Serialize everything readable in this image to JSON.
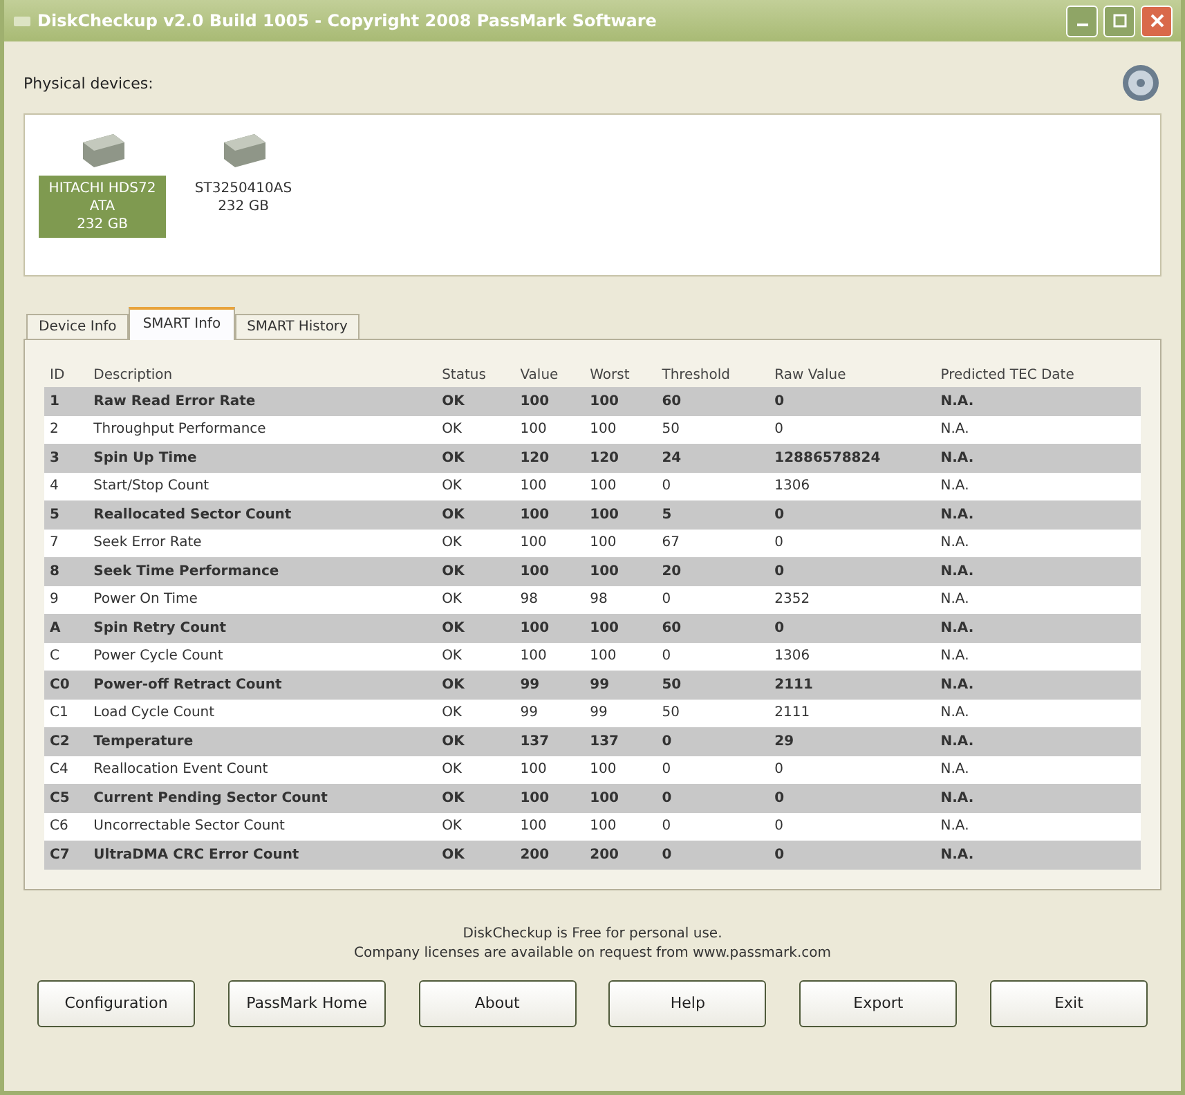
{
  "window": {
    "title": "DiskCheckup v2.0 Build 1005 - Copyright 2008 PassMark Software"
  },
  "devices_label": "Physical devices:",
  "devices": [
    {
      "lines": [
        "HITACHI HDS72",
        "ATA",
        "232 GB"
      ],
      "selected": true
    },
    {
      "lines": [
        "ST3250410AS",
        "232 GB"
      ],
      "selected": false
    }
  ],
  "tabs": [
    {
      "label": "Device Info",
      "selected": false
    },
    {
      "label": "SMART Info",
      "selected": true
    },
    {
      "label": "SMART History",
      "selected": false
    }
  ],
  "table": {
    "columns": [
      "ID",
      "Description",
      "Status",
      "Value",
      "Worst",
      "Threshold",
      "Raw Value",
      "Predicted TEC Date"
    ],
    "rows": [
      [
        "1",
        "Raw Read Error Rate",
        "OK",
        "100",
        "100",
        "60",
        "0",
        "N.A."
      ],
      [
        "2",
        "Throughput Performance",
        "OK",
        "100",
        "100",
        "50",
        "0",
        "N.A."
      ],
      [
        "3",
        "Spin Up Time",
        "OK",
        "120",
        "120",
        "24",
        "12886578824",
        "N.A."
      ],
      [
        "4",
        "Start/Stop Count",
        "OK",
        "100",
        "100",
        "0",
        "1306",
        "N.A."
      ],
      [
        "5",
        "Reallocated Sector Count",
        "OK",
        "100",
        "100",
        "5",
        "0",
        "N.A."
      ],
      [
        "7",
        "Seek Error Rate",
        "OK",
        "100",
        "100",
        "67",
        "0",
        "N.A."
      ],
      [
        "8",
        "Seek Time Performance",
        "OK",
        "100",
        "100",
        "20",
        "0",
        "N.A."
      ],
      [
        "9",
        "Power On Time",
        "OK",
        "98",
        "98",
        "0",
        "2352",
        "N.A."
      ],
      [
        "A",
        "Spin Retry Count",
        "OK",
        "100",
        "100",
        "60",
        "0",
        "N.A."
      ],
      [
        "C",
        "Power Cycle Count",
        "OK",
        "100",
        "100",
        "0",
        "1306",
        "N.A."
      ],
      [
        "C0",
        "Power-off Retract Count",
        "OK",
        "99",
        "99",
        "50",
        "2111",
        "N.A."
      ],
      [
        "C1",
        "Load Cycle Count",
        "OK",
        "99",
        "99",
        "50",
        "2111",
        "N.A."
      ],
      [
        "C2",
        "Temperature",
        "OK",
        "137",
        "137",
        "0",
        "29",
        "N.A."
      ],
      [
        "C4",
        "Reallocation Event Count",
        "OK",
        "100",
        "100",
        "0",
        "0",
        "N.A."
      ],
      [
        "C5",
        "Current Pending Sector Count",
        "OK",
        "100",
        "100",
        "0",
        "0",
        "N.A."
      ],
      [
        "C6",
        "Uncorrectable Sector Count",
        "OK",
        "100",
        "100",
        "0",
        "0",
        "N.A."
      ],
      [
        "C7",
        "UltraDMA CRC Error Count",
        "OK",
        "200",
        "200",
        "0",
        "0",
        "N.A."
      ]
    ]
  },
  "notice": [
    "DiskCheckup is Free for personal use.",
    "Company licenses are available on request from www.passmark.com"
  ],
  "buttons": [
    "Configuration",
    "PassMark Home",
    "About",
    "Help",
    "Export",
    "Exit"
  ]
}
